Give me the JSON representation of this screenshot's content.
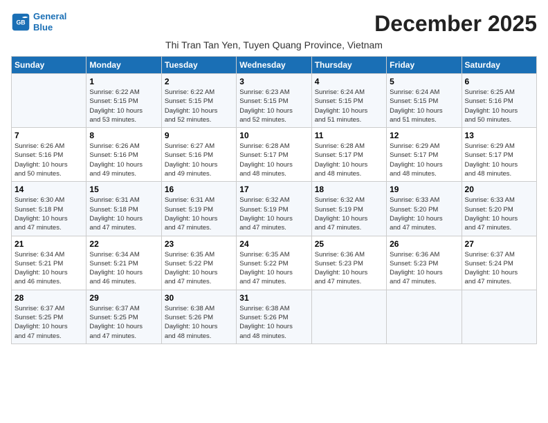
{
  "header": {
    "logo_line1": "General",
    "logo_line2": "Blue",
    "month_title": "December 2025",
    "subtitle": "Thi Tran Tan Yen, Tuyen Quang Province, Vietnam"
  },
  "days_of_week": [
    "Sunday",
    "Monday",
    "Tuesday",
    "Wednesday",
    "Thursday",
    "Friday",
    "Saturday"
  ],
  "weeks": [
    [
      {
        "day": "",
        "info": ""
      },
      {
        "day": "1",
        "info": "Sunrise: 6:22 AM\nSunset: 5:15 PM\nDaylight: 10 hours\nand 53 minutes."
      },
      {
        "day": "2",
        "info": "Sunrise: 6:22 AM\nSunset: 5:15 PM\nDaylight: 10 hours\nand 52 minutes."
      },
      {
        "day": "3",
        "info": "Sunrise: 6:23 AM\nSunset: 5:15 PM\nDaylight: 10 hours\nand 52 minutes."
      },
      {
        "day": "4",
        "info": "Sunrise: 6:24 AM\nSunset: 5:15 PM\nDaylight: 10 hours\nand 51 minutes."
      },
      {
        "day": "5",
        "info": "Sunrise: 6:24 AM\nSunset: 5:15 PM\nDaylight: 10 hours\nand 51 minutes."
      },
      {
        "day": "6",
        "info": "Sunrise: 6:25 AM\nSunset: 5:16 PM\nDaylight: 10 hours\nand 50 minutes."
      }
    ],
    [
      {
        "day": "7",
        "info": "Sunrise: 6:26 AM\nSunset: 5:16 PM\nDaylight: 10 hours\nand 50 minutes."
      },
      {
        "day": "8",
        "info": "Sunrise: 6:26 AM\nSunset: 5:16 PM\nDaylight: 10 hours\nand 49 minutes."
      },
      {
        "day": "9",
        "info": "Sunrise: 6:27 AM\nSunset: 5:16 PM\nDaylight: 10 hours\nand 49 minutes."
      },
      {
        "day": "10",
        "info": "Sunrise: 6:28 AM\nSunset: 5:17 PM\nDaylight: 10 hours\nand 48 minutes."
      },
      {
        "day": "11",
        "info": "Sunrise: 6:28 AM\nSunset: 5:17 PM\nDaylight: 10 hours\nand 48 minutes."
      },
      {
        "day": "12",
        "info": "Sunrise: 6:29 AM\nSunset: 5:17 PM\nDaylight: 10 hours\nand 48 minutes."
      },
      {
        "day": "13",
        "info": "Sunrise: 6:29 AM\nSunset: 5:17 PM\nDaylight: 10 hours\nand 48 minutes."
      }
    ],
    [
      {
        "day": "14",
        "info": "Sunrise: 6:30 AM\nSunset: 5:18 PM\nDaylight: 10 hours\nand 47 minutes."
      },
      {
        "day": "15",
        "info": "Sunrise: 6:31 AM\nSunset: 5:18 PM\nDaylight: 10 hours\nand 47 minutes."
      },
      {
        "day": "16",
        "info": "Sunrise: 6:31 AM\nSunset: 5:19 PM\nDaylight: 10 hours\nand 47 minutes."
      },
      {
        "day": "17",
        "info": "Sunrise: 6:32 AM\nSunset: 5:19 PM\nDaylight: 10 hours\nand 47 minutes."
      },
      {
        "day": "18",
        "info": "Sunrise: 6:32 AM\nSunset: 5:19 PM\nDaylight: 10 hours\nand 47 minutes."
      },
      {
        "day": "19",
        "info": "Sunrise: 6:33 AM\nSunset: 5:20 PM\nDaylight: 10 hours\nand 47 minutes."
      },
      {
        "day": "20",
        "info": "Sunrise: 6:33 AM\nSunset: 5:20 PM\nDaylight: 10 hours\nand 47 minutes."
      }
    ],
    [
      {
        "day": "21",
        "info": "Sunrise: 6:34 AM\nSunset: 5:21 PM\nDaylight: 10 hours\nand 46 minutes."
      },
      {
        "day": "22",
        "info": "Sunrise: 6:34 AM\nSunset: 5:21 PM\nDaylight: 10 hours\nand 46 minutes."
      },
      {
        "day": "23",
        "info": "Sunrise: 6:35 AM\nSunset: 5:22 PM\nDaylight: 10 hours\nand 47 minutes."
      },
      {
        "day": "24",
        "info": "Sunrise: 6:35 AM\nSunset: 5:22 PM\nDaylight: 10 hours\nand 47 minutes."
      },
      {
        "day": "25",
        "info": "Sunrise: 6:36 AM\nSunset: 5:23 PM\nDaylight: 10 hours\nand 47 minutes."
      },
      {
        "day": "26",
        "info": "Sunrise: 6:36 AM\nSunset: 5:23 PM\nDaylight: 10 hours\nand 47 minutes."
      },
      {
        "day": "27",
        "info": "Sunrise: 6:37 AM\nSunset: 5:24 PM\nDaylight: 10 hours\nand 47 minutes."
      }
    ],
    [
      {
        "day": "28",
        "info": "Sunrise: 6:37 AM\nSunset: 5:25 PM\nDaylight: 10 hours\nand 47 minutes."
      },
      {
        "day": "29",
        "info": "Sunrise: 6:37 AM\nSunset: 5:25 PM\nDaylight: 10 hours\nand 47 minutes."
      },
      {
        "day": "30",
        "info": "Sunrise: 6:38 AM\nSunset: 5:26 PM\nDaylight: 10 hours\nand 48 minutes."
      },
      {
        "day": "31",
        "info": "Sunrise: 6:38 AM\nSunset: 5:26 PM\nDaylight: 10 hours\nand 48 minutes."
      },
      {
        "day": "",
        "info": ""
      },
      {
        "day": "",
        "info": ""
      },
      {
        "day": "",
        "info": ""
      }
    ]
  ]
}
